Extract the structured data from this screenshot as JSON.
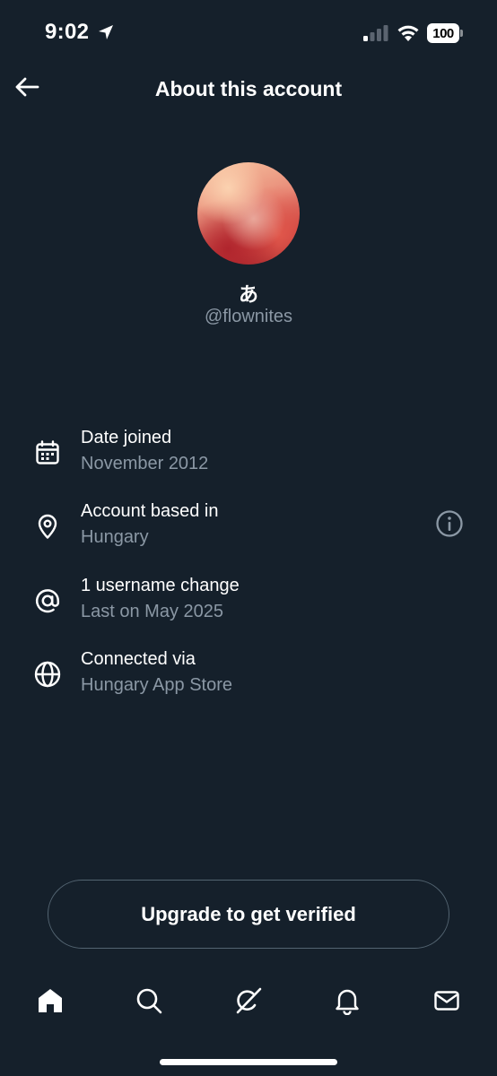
{
  "status_bar": {
    "time": "9:02",
    "battery": "100",
    "icons": [
      "location-arrow-icon",
      "signal-icon",
      "wifi-icon",
      "battery-icon"
    ]
  },
  "header": {
    "title": "About this account",
    "back_icon": "arrow-left-icon"
  },
  "profile": {
    "display_name": "あ",
    "handle": "@flownites"
  },
  "info": {
    "rows": [
      {
        "icon": "calendar-icon",
        "title": "Date joined",
        "subtitle": "November 2012"
      },
      {
        "icon": "location-pin-icon",
        "title": "Account based in",
        "subtitle": "Hungary",
        "action_icon": "info-icon"
      },
      {
        "icon": "at-icon",
        "title": "1 username change",
        "subtitle": "Last on May 2025"
      },
      {
        "icon": "globe-icon",
        "title": "Connected via",
        "subtitle": "Hungary App Store"
      }
    ]
  },
  "upgrade": {
    "label": "Upgrade to get verified"
  },
  "tab_bar": {
    "items": [
      "home-icon",
      "search-icon",
      "grok-icon",
      "notifications-icon",
      "messages-icon"
    ]
  },
  "colors": {
    "background": "#15202b",
    "text_primary": "#ffffff",
    "text_secondary": "#8b98a5",
    "border": "#536471"
  }
}
